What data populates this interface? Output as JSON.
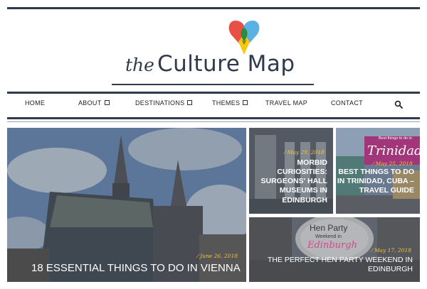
{
  "logo": {
    "prefix": "the",
    "name": "Culture Map",
    "colors": {
      "red": "#e7473d",
      "blue": "#4aa8e0",
      "yellow": "#f6c90e",
      "green": "#2e8b3e",
      "dark": "#2f3b4c"
    }
  },
  "nav": {
    "items": [
      {
        "label": "HOME",
        "dropdown": false
      },
      {
        "label": "ABOUT",
        "dropdown": true
      },
      {
        "label": "DESTINATIONS",
        "dropdown": true
      },
      {
        "label": "THEMES",
        "dropdown": true
      },
      {
        "label": "TRAVEL MAP",
        "dropdown": false
      },
      {
        "label": "CONTACT",
        "dropdown": false
      }
    ],
    "search_icon": "search-icon"
  },
  "posts": [
    {
      "date": "June 26, 2018",
      "title": "18 ESSENTIAL THINGS TO DO IN VIENNA"
    },
    {
      "date": "May 29, 2018",
      "title": "MORBID CURIOSITIES: SURGEONS' HALL MUSEUMS IN EDINBURGH"
    },
    {
      "date": "May 25, 2018",
      "title": "BEST THINGS TO DO IN TRINIDAD, CUBA – TRAVEL GUIDE"
    },
    {
      "date": "May 17, 2018",
      "title": "THE PERFECT HEN PARTY WEEKEND IN EDINBURGH"
    }
  ],
  "image_text": {
    "trinidad_top": "Best things to do in",
    "trinidad_word": "Trinidad",
    "hen_title": "Hen Party",
    "hen_sub": "Weekend in",
    "hen_script": "Edinburgh"
  }
}
